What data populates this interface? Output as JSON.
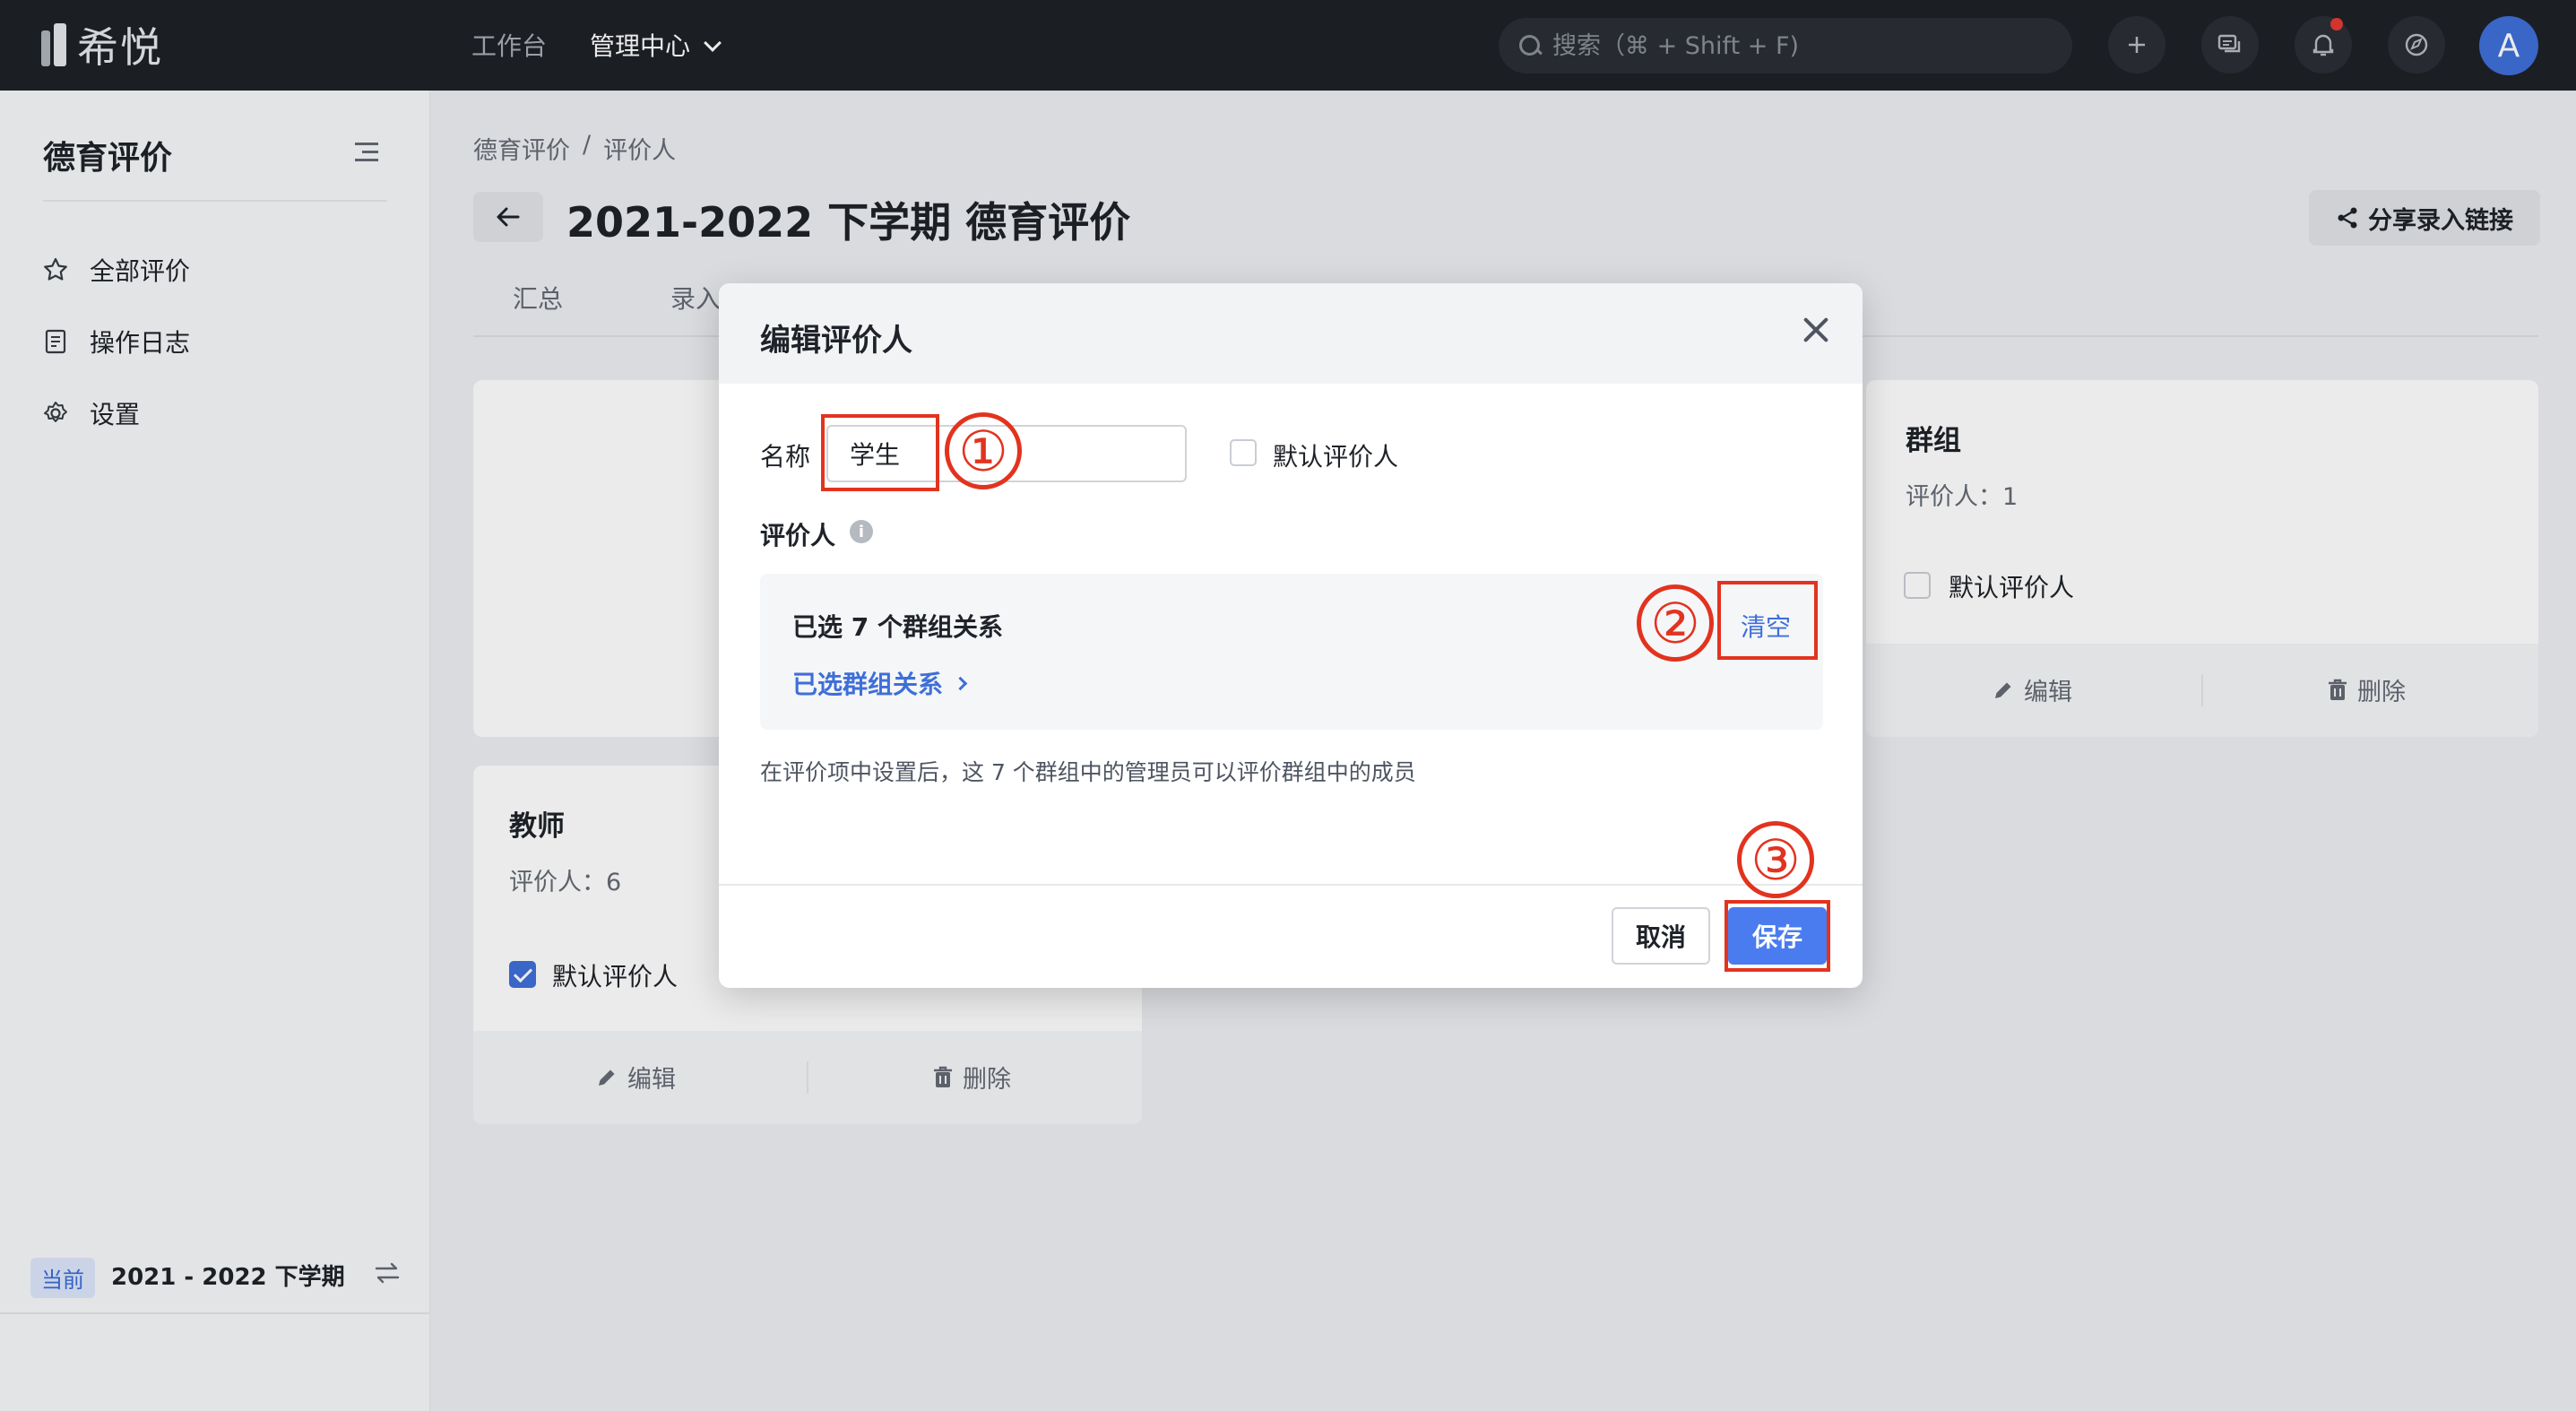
{
  "topbar": {
    "logo_text": "希悦",
    "nav": [
      {
        "label": "工作台"
      },
      {
        "label": "管理中心"
      }
    ],
    "search_placeholder": "搜索（⌘ + Shift + F)",
    "avatar_letter": "A"
  },
  "sidebar": {
    "title": "德育评价",
    "items": [
      {
        "label": "全部评价",
        "icon": "star-icon"
      },
      {
        "label": "操作日志",
        "icon": "log-icon"
      },
      {
        "label": "设置",
        "icon": "gear-icon"
      }
    ],
    "term_tag": "当前",
    "term": "2021 - 2022 下学期"
  },
  "main": {
    "breadcrumb": [
      "德育评价",
      "评价人"
    ],
    "breadcrumb_sep": "/",
    "title": "2021-2022 下学期 德育评价",
    "share_label": "分享录入链接",
    "tabs": [
      {
        "label": "汇总"
      },
      {
        "label": "录入"
      }
    ],
    "cards": [
      {
        "title": "群组",
        "sub": "评价人：1",
        "default_label": "默认评价人",
        "default_checked": false,
        "edit": "编辑",
        "delete": "删除"
      },
      {
        "title": "教师",
        "sub": "评价人：6",
        "default_label": "默认评价人",
        "default_checked": true,
        "edit": "编辑",
        "delete": "删除"
      }
    ]
  },
  "modal": {
    "title": "编辑评价人",
    "name_label": "名称",
    "name_value": "学生",
    "default_label": "默认评价人",
    "evaluator_label": "评价人",
    "selected_count": "已选 7 个群组关系",
    "selected_link": "已选群组关系",
    "clear_label": "清空",
    "hint": "在评价项中设置后，这 7 个群组中的管理员可以评价群组中的成员",
    "cancel_label": "取消",
    "save_label": "保存"
  },
  "annotations": [
    "①",
    "②",
    "③"
  ],
  "colors": {
    "accent": "#3e6fd8",
    "primary_button": "#4a7cf0",
    "annotation_red": "#e2331f",
    "topbar": "#1e2126"
  }
}
